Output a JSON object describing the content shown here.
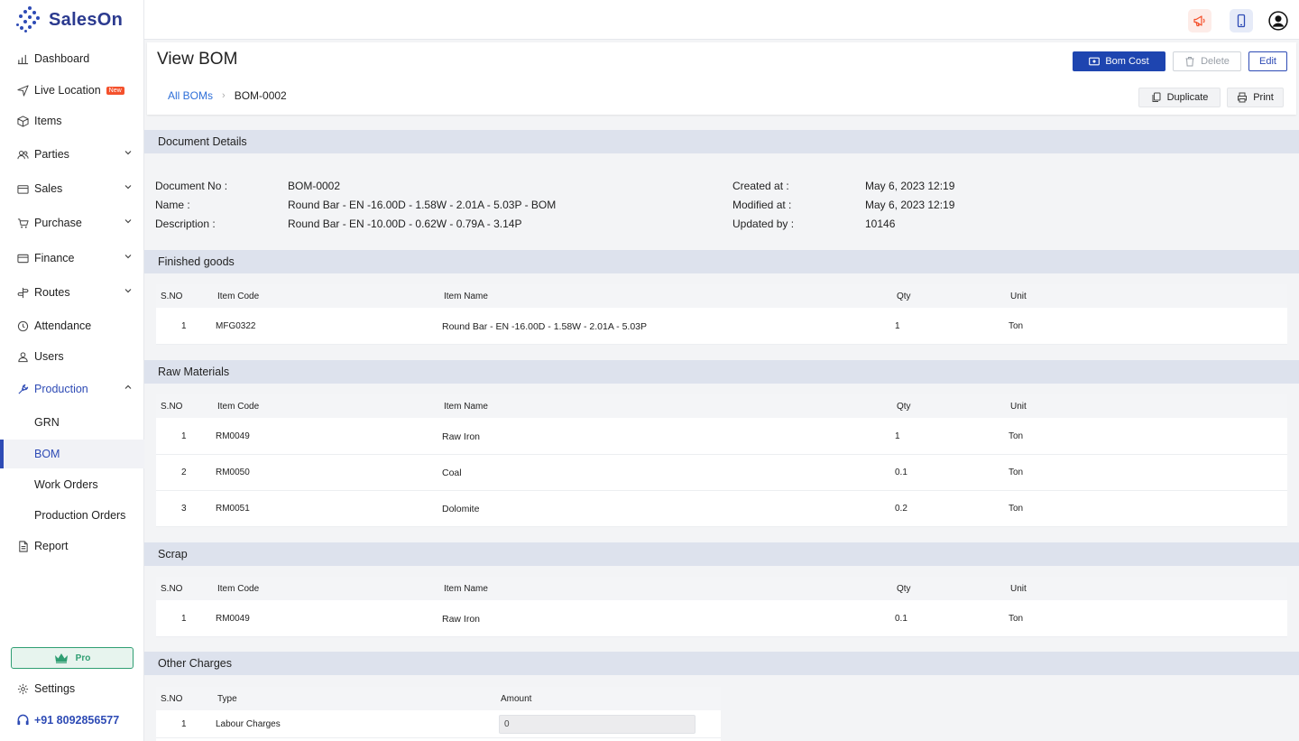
{
  "app": {
    "name": "SalesOn"
  },
  "sidebar": {
    "items": [
      {
        "label": "Dashboard",
        "icon": "bar-chart-icon"
      },
      {
        "label": "Live Location",
        "icon": "navigation-icon",
        "badge": "New"
      },
      {
        "label": "Items",
        "icon": "box-icon"
      },
      {
        "label": "Parties",
        "icon": "users-icon",
        "expandable": true
      },
      {
        "label": "Sales",
        "icon": "wallet-icon",
        "expandable": true
      },
      {
        "label": "Purchase",
        "icon": "cart-icon",
        "expandable": true
      },
      {
        "label": "Finance",
        "icon": "card-icon",
        "expandable": true
      },
      {
        "label": "Routes",
        "icon": "signpost-icon",
        "expandable": true
      },
      {
        "label": "Attendance",
        "icon": "clock-icon"
      },
      {
        "label": "Users",
        "icon": "user-icon"
      },
      {
        "label": "Production",
        "icon": "wrench-icon",
        "expandable": true,
        "expanded": true
      }
    ],
    "production_sub": [
      {
        "label": "GRN"
      },
      {
        "label": "BOM",
        "current": true
      },
      {
        "label": "Work Orders"
      },
      {
        "label": "Production Orders"
      }
    ],
    "report": {
      "label": "Report",
      "icon": "file-icon"
    },
    "pro_label": "Pro",
    "settings_label": "Settings",
    "phone": "+91 8092856577"
  },
  "header": {
    "title": "View BOM",
    "buttons": {
      "bom_cost": "Bom Cost",
      "delete": "Delete",
      "edit": "Edit",
      "duplicate": "Duplicate",
      "print": "Print"
    },
    "breadcrumb": {
      "parent": "All BOMs",
      "current": "BOM-0002"
    }
  },
  "document_details": {
    "section_title": "Document Details",
    "left": [
      {
        "label": "Document No :",
        "value": "BOM-0002"
      },
      {
        "label": "Name :",
        "value": "Round Bar - EN -16.00D - 1.58W - 2.01A - 5.03P - BOM"
      },
      {
        "label": "Description :",
        "value": "Round Bar - EN -10.00D - 0.62W - 0.79A - 3.14P"
      }
    ],
    "right": [
      {
        "label": "Created at :",
        "value": "May 6, 2023 12:19"
      },
      {
        "label": "Modified at :",
        "value": "May 6, 2023 12:19"
      },
      {
        "label": "Updated by :",
        "value": "10146"
      }
    ]
  },
  "columns": {
    "sno": "S.NO",
    "item_code": "Item Code",
    "item_name": "Item Name",
    "qty": "Qty",
    "unit": "Unit",
    "type": "Type",
    "amount": "Amount"
  },
  "finished_goods": {
    "section_title": "Finished goods",
    "rows": [
      {
        "sno": "1",
        "code": "MFG0322",
        "name": "Round Bar - EN -16.00D - 1.58W - 2.01A - 5.03P",
        "qty": "1",
        "unit": "Ton"
      }
    ]
  },
  "raw_materials": {
    "section_title": "Raw Materials",
    "rows": [
      {
        "sno": "1",
        "code": "RM0049",
        "name": "Raw Iron",
        "qty": "1",
        "unit": "Ton"
      },
      {
        "sno": "2",
        "code": "RM0050",
        "name": "Coal",
        "qty": "0.1",
        "unit": "Ton"
      },
      {
        "sno": "3",
        "code": "RM0051",
        "name": "Dolomite",
        "qty": "0.2",
        "unit": "Ton"
      }
    ]
  },
  "scrap": {
    "section_title": "Scrap",
    "rows": [
      {
        "sno": "1",
        "code": "RM0049",
        "name": "Raw Iron",
        "qty": "0.1",
        "unit": "Ton"
      }
    ]
  },
  "other_charges": {
    "section_title": "Other Charges",
    "rows": [
      {
        "sno": "1",
        "type": "Labour Charges",
        "amount": "0"
      }
    ]
  },
  "colors": {
    "primary": "#1e45b0",
    "accent": "#2e4bb5",
    "section_bg": "#dde2ed",
    "badge": "#f4512c",
    "pro": "#2f9e72"
  }
}
